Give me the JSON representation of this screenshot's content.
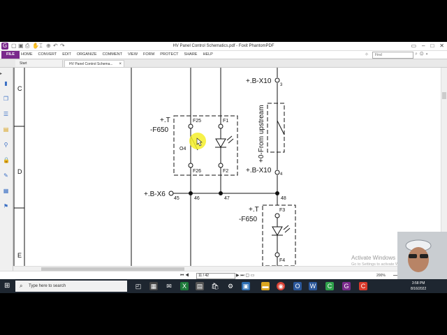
{
  "titlebar": {
    "title": "HV Panel Control Schematics.pdf - Foxit PhantomPDF"
  },
  "ribbon": {
    "file_label": "FILE",
    "menu": [
      "HOME",
      "CONVERT",
      "EDIT",
      "ORGANIZE",
      "COMMENT",
      "VIEW",
      "FORM",
      "PROTECT",
      "SHARE",
      "HELP"
    ],
    "find_placeholder": "Find"
  },
  "tabs": {
    "start": "Start",
    "document": "HV Panel Control Schema...",
    "close": "×"
  },
  "schematic": {
    "row_labels": [
      "C",
      "D",
      "E"
    ],
    "x10_top": "+.B-X10",
    "x10_top_pin": "3",
    "x10_bottom": "+.B-X10",
    "x10_bottom_pin": "4",
    "from_upstream": "+0-From upstream",
    "plus_t_1": "+.T",
    "f650_1": "-F650",
    "f25": "F25",
    "f1": "F1",
    "o4": "O4",
    "f26": "F26",
    "f2": "F2",
    "x6": "+.B-X6",
    "n45": "45",
    "n46": "46",
    "n47": "47",
    "n48": "48",
    "plus_t_2": "+.T",
    "f650_2": "-F650",
    "f3": "F3",
    "f4": "F4"
  },
  "statusbar": {
    "page_value": "11 / 42",
    "zoom": "200%"
  },
  "watermark": {
    "title": "Activate Windows",
    "subtitle": "Go to Settings to activate Windows."
  },
  "taskbar": {
    "search_placeholder": "Type here to search",
    "time": "3:58 PM",
    "date": "8/16/2022"
  },
  "colors": {
    "foxit_purple": "#7a2a8c",
    "highlight": "#f5ee2a",
    "taskbar": "#1e2630"
  }
}
